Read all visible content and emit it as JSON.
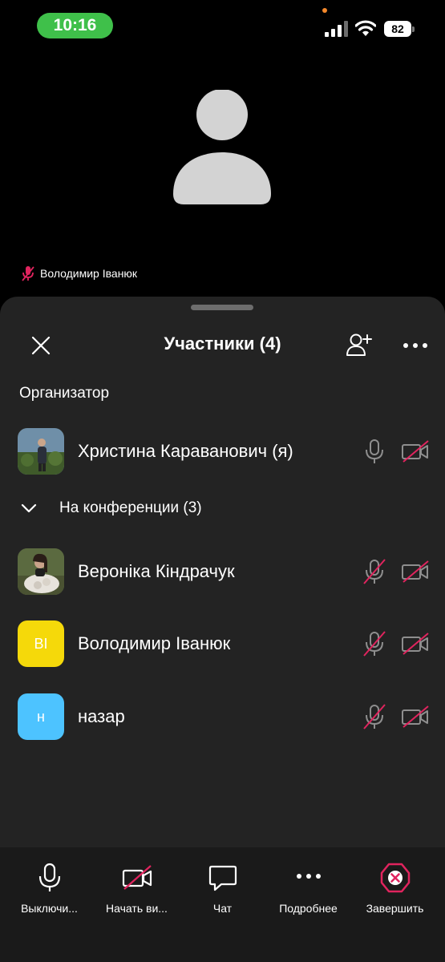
{
  "status_bar": {
    "time": "10:16",
    "battery": "82",
    "time_pill_color": "#3fc04a",
    "indicator_color": "#f5892b"
  },
  "video": {
    "speaker_name": "Володимир Іванюк",
    "speaker_muted": true
  },
  "sheet": {
    "title": "Участники (4)",
    "host_section": "Организатор",
    "host": {
      "name": "Христина Караванович (я)",
      "avatar": "photo",
      "mic": "on",
      "camera": "off"
    },
    "conference_section": "На конференции (3)",
    "participants": [
      {
        "name": "Вероніка Кіндрачук",
        "avatar": "photo",
        "mic": "off",
        "camera": "off"
      },
      {
        "name": "Володимир Іванюк",
        "avatar": "initials",
        "initials": "ВІ",
        "avatar_color": "#f5d90a",
        "mic": "off",
        "camera": "off"
      },
      {
        "name": "назар",
        "avatar": "initials",
        "initials": "н",
        "avatar_color": "#4dc3ff",
        "mic": "off",
        "camera": "off"
      }
    ]
  },
  "toolbar": {
    "mute_label": "Выключи...",
    "video_label": "Начать ви...",
    "chat_label": "Чат",
    "more_label": "Подробнее",
    "end_label": "Завершить",
    "end_color": "#e0245e"
  }
}
